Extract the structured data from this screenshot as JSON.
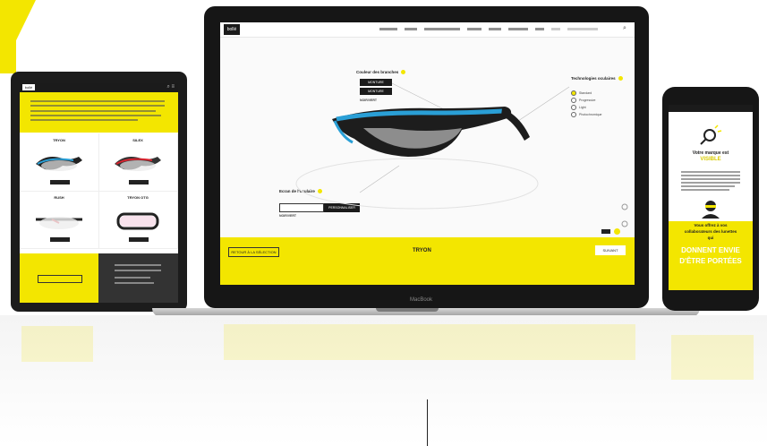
{
  "colors": {
    "accent": "#f3e600",
    "dark": "#1b1b1b",
    "lens_blue": "#2a9fd6"
  },
  "laptop": {
    "brand": "MacBook",
    "logo": "bollé",
    "labels": {
      "frame": "Couleur des branches",
      "lens_tech": "Technologies oculaires",
      "lens": "Ecran de l'oculaire",
      "frame_btn": "MONTURE",
      "frame_value": "MONTURE",
      "lens_btn": "PERSONNALISER",
      "lens_value": "NOIR/VERT"
    },
    "options": [
      "Standard",
      "Progressive",
      "Light",
      "Photochromique"
    ],
    "bottom": {
      "back": "RETOUR À LA SÉLECTION",
      "product": "TRYON",
      "next": "SUIVANT"
    }
  },
  "tablet": {
    "logo": "bollé",
    "products": [
      {
        "name": "TRYON"
      },
      {
        "name": "SILEX"
      },
      {
        "name": "RUSH"
      },
      {
        "name": "TRYON OTG"
      }
    ]
  },
  "phone": {
    "headline_1": "Votre marque est",
    "headline_2": "VISIBLE",
    "headline_3": "Vous offrez à vos",
    "headline_4": "collaborateurs des lunettes",
    "headline_5": "qui",
    "headline_6": "DONNENT ENVIE",
    "headline_7": "D'ÊTRE PORTÉES"
  }
}
